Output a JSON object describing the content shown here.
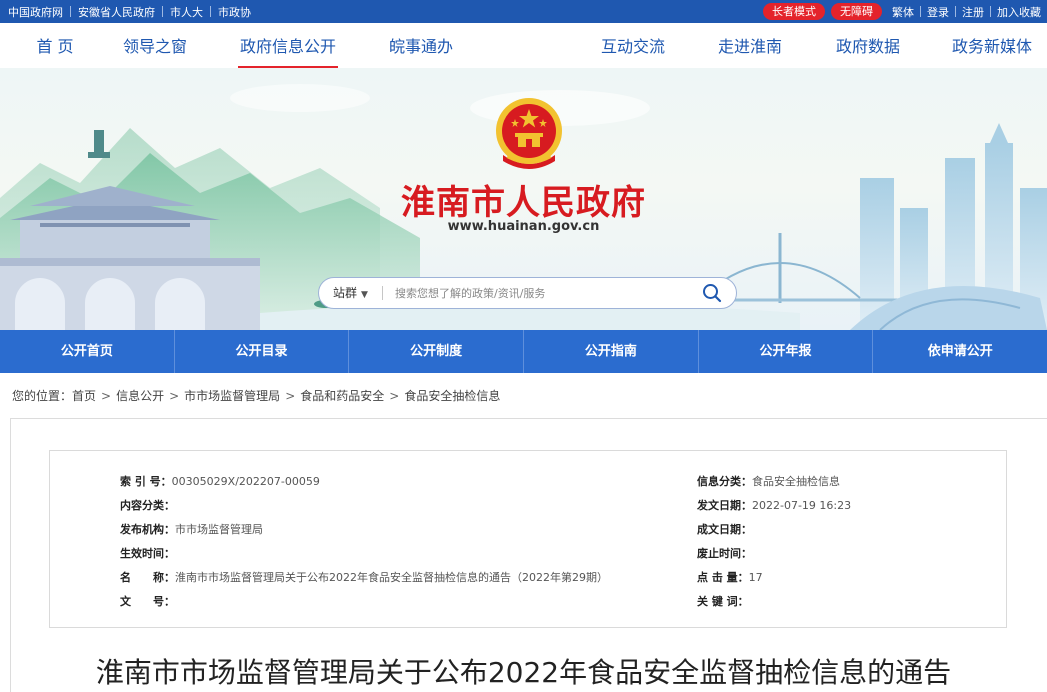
{
  "topbar": {
    "links": [
      "中国政府网",
      "安徽省人民政府",
      "市人大",
      "市政协"
    ],
    "elder_mode": "长者模式",
    "accessibility": "无障碍",
    "right_links": [
      "繁体",
      "登录",
      "注册",
      "加入收藏"
    ],
    "colors": {
      "bar": "#1f58b0",
      "pill": "#e4232b"
    }
  },
  "mainnav": {
    "items": [
      "首 页",
      "领导之窗",
      "政府信息公开",
      "皖事通办",
      "互动交流",
      "走进淮南",
      "政府数据",
      "政务新媒体"
    ],
    "active": "政府信息公开"
  },
  "banner": {
    "emblem": "national-emblem",
    "title": "淮南市人民政府",
    "url": "www.huainan.gov.cn"
  },
  "search": {
    "scope": "站群",
    "placeholder": "搜索您想了解的政策/资讯/服务",
    "icon": "search-icon"
  },
  "subnav": {
    "items": [
      "公开首页",
      "公开目录",
      "公开制度",
      "公开指南",
      "公开年报",
      "依申请公开"
    ]
  },
  "breadcrumb": {
    "label": "您的位置：",
    "items": [
      "首页",
      "信息公开",
      "市市场监督管理局",
      "食品和药品安全",
      "食品安全抽检信息"
    ]
  },
  "info": {
    "left": [
      {
        "k": "索 引 号：",
        "v": "00305029X/202207-00059"
      },
      {
        "k": "内容分类：",
        "v": ""
      },
      {
        "k": "发布机构：",
        "v": "市市场监督管理局"
      },
      {
        "k": "生效时间：",
        "v": ""
      },
      {
        "k": "名　　称：",
        "v": "淮南市市场监督管理局关于公布2022年食品安全监督抽检信息的通告（2022年第29期）"
      },
      {
        "k": "文　　号：",
        "v": ""
      }
    ],
    "right": [
      {
        "k": "信息分类：",
        "v": "食品安全抽检信息"
      },
      {
        "k": "发文日期：",
        "v": "2022-07-19 16:23"
      },
      {
        "k": "成文日期：",
        "v": ""
      },
      {
        "k": "废止时间：",
        "v": ""
      },
      {
        "k": "点 击 量：",
        "v": "17"
      },
      {
        "k": "关 键 词：",
        "v": ""
      }
    ]
  },
  "document": {
    "title": "淮南市市场监督管理局关于公布2022年食品安全监督抽检信息的通告"
  }
}
